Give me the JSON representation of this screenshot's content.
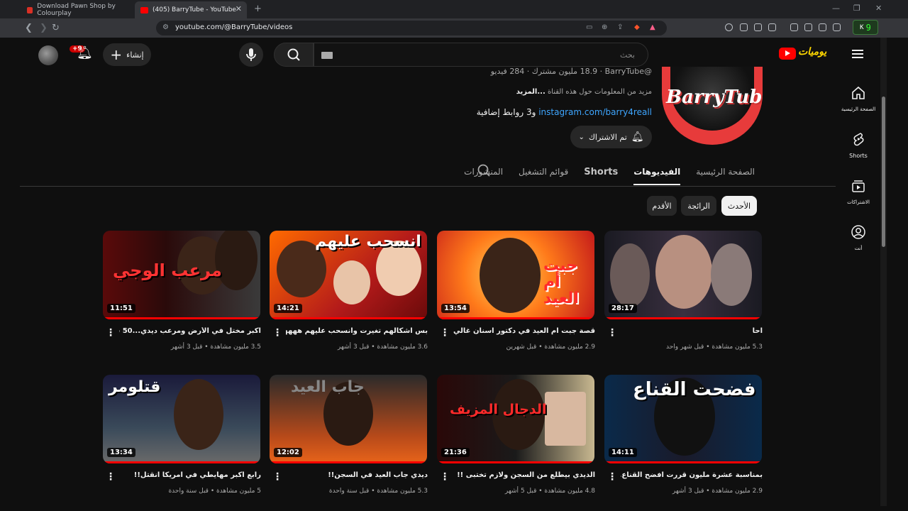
{
  "browser": {
    "tabs": [
      {
        "title": "Download Pawn Shop by Colourplay"
      },
      {
        "title": "(405) BarryTube - YouTube"
      }
    ],
    "url": "youtube.com/@BarryTube/videos",
    "extension_badge": "9"
  },
  "header": {
    "search_placeholder": "بحث",
    "create_label": "إنشاء",
    "notifications_badge": "+9",
    "brand": "يوميات"
  },
  "channel": {
    "avatar_text": "BarryTube",
    "handle_line": "@BarryTube · ‏18.9 مليون مشترك · ‏284 فيديو",
    "description": "مزيد من المعلومات حول هذه القناة",
    "description_more": "...المزيد",
    "link_text": "instagram.com/barry4reall",
    "link_suffix": " و3 روابط إضافية",
    "subscribed_label": "تم الاشتراك"
  },
  "tabs": [
    {
      "label": "الصفحة الرئيسية"
    },
    {
      "label": "الفيديوهات"
    },
    {
      "label": "Shorts"
    },
    {
      "label": "قوائم التشغيل"
    },
    {
      "label": "المنشورات"
    }
  ],
  "filters": {
    "newest": "الأحدث",
    "popular": "الرائجة",
    "oldest": "الأقدم"
  },
  "sidebar": {
    "home": "الصفحة الرئيسية",
    "shorts": "Shorts",
    "subscriptions": "الاشتراكات",
    "you": "أنت"
  },
  "videos": [
    {
      "title": "اكبر مختل في الأرض ومرعب ديدي...50 سنت",
      "meta": "3.5 مليون مشاهدة • قبل 3 أشهر",
      "duration": "11:51",
      "thumb_text": "مرعب الوجي"
    },
    {
      "title": "بس اشكالهم تغيرت وانسحب عليهم هههههه",
      "meta": "3.6 مليون مشاهدة • قبل 3 أشهر",
      "duration": "14:21",
      "thumb_text": "انسحب عليهم"
    },
    {
      "title": "قصة جبت ام العيد في دكتور اسنان غالي!",
      "meta": "2.9 مليون مشاهدة • قبل شهرين",
      "duration": "13:54",
      "thumb_text": "جبت أم العيد"
    },
    {
      "title": "احا",
      "meta": "5.3 مليون مشاهدة • قبل شهر واحد",
      "duration": "28:17",
      "thumb_text": ""
    },
    {
      "title": "رابع اكبر مهايطي في امريكا انقتل!!",
      "meta": "5 مليون مشاهدة • قبل سنة واحدة",
      "duration": "13:34",
      "thumb_text": "قتلومر"
    },
    {
      "title": "ديدي جاب العيد في السجن!!",
      "meta": "5.3 مليون مشاهدة • قبل سنة واحدة",
      "duration": "12:02",
      "thumb_text": "جاب العيد"
    },
    {
      "title": "الديدي بيطلع من السجن ولازم تختبى !!",
      "meta": "4.8 مليون مشاهدة • قبل 5 أشهر",
      "duration": "21:36",
      "thumb_text": "الدجال المزيف"
    },
    {
      "title": "بمناسبة عشرة مليون قررت افضح القناع..",
      "meta": "2.9 مليون مشاهدة • قبل 3 أشهر",
      "duration": "14:11",
      "thumb_text": "فضحت القناع"
    }
  ]
}
